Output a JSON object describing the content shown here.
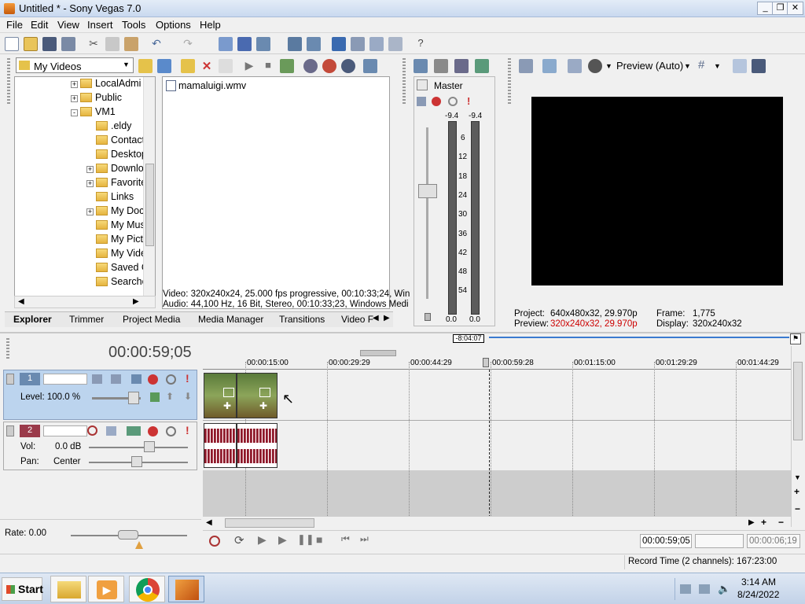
{
  "window": {
    "title": "Untitled * - Sony Vegas 7.0",
    "min": "_",
    "restore": "❐",
    "close": "✕"
  },
  "menu": [
    "File",
    "Edit",
    "View",
    "Insert",
    "Tools",
    "Options",
    "Help"
  ],
  "explorer": {
    "location": "My Videos",
    "tree": [
      {
        "label": "LocalAdmi",
        "expander": "+"
      },
      {
        "label": "Public",
        "expander": "+"
      },
      {
        "label": "VM1",
        "expander": "-"
      },
      {
        "label": ".eldy",
        "expander": ""
      },
      {
        "label": "Contact",
        "expander": ""
      },
      {
        "label": "Desktop",
        "expander": ""
      },
      {
        "label": "Downlo",
        "expander": "+"
      },
      {
        "label": "Favorite",
        "expander": "+"
      },
      {
        "label": "Links",
        "expander": ""
      },
      {
        "label": "My Doc",
        "expander": "+"
      },
      {
        "label": "My Mus",
        "expander": ""
      },
      {
        "label": "My Pict",
        "expander": ""
      },
      {
        "label": "My Vide",
        "expander": ""
      },
      {
        "label": "Saved G",
        "expander": ""
      },
      {
        "label": "Searche",
        "expander": ""
      }
    ],
    "files": [
      "mamaluigi.wmv"
    ],
    "info_video": "Video: 320x240x24, 25.000 fps progressive, 00:10:33;24, Win",
    "info_audio": "Audio: 44,100 Hz, 16 Bit, Stereo, 00:10:33;23, Windows Medi",
    "tabs": [
      "Explorer",
      "Trimmer",
      "Project Media",
      "Media Manager",
      "Transitions",
      "Video F"
    ]
  },
  "mixer": {
    "label": "Master",
    "peak_left": "-9.4",
    "peak_right": "-9.4",
    "scale": [
      "6",
      "12",
      "18",
      "24",
      "30",
      "36",
      "42",
      "48",
      "54"
    ],
    "foot_left": "0.0",
    "foot_right": "0.0"
  },
  "preview": {
    "mode": "Preview (Auto)",
    "project_label": "Project:",
    "project_value": "640x480x32, 29.970p",
    "preview_label": "Preview:",
    "preview_value": "320x240x32, 29.970p",
    "frame_label": "Frame:",
    "frame_value": "1,775",
    "display_label": "Display:",
    "display_value": "320x240x32"
  },
  "timeline": {
    "time": "00:00:59;05",
    "marker": "-8:04:07",
    "ticks": [
      "00:00:15:00",
      "00:00:29:29",
      "00:00:44:29",
      "00:00:59:28",
      "00:01:15:00",
      "00:01:29:29",
      "00:01:44:29"
    ],
    "video_track": {
      "number": "1",
      "level": "Level: 100.0 %"
    },
    "audio_track": {
      "number": "2",
      "vol_label": "Vol:",
      "vol_value": "0.0 dB",
      "pan_label": "Pan:",
      "pan_value": "Center"
    },
    "rate": "Rate: 0.00",
    "cursor_time": "00:00:59;05",
    "length_time": "00:00:06;19",
    "record_time": "Record Time (2 channels): 167:23:00"
  },
  "taskbar": {
    "start": "Start",
    "time": "3:14 AM",
    "date": "8/24/2022"
  }
}
